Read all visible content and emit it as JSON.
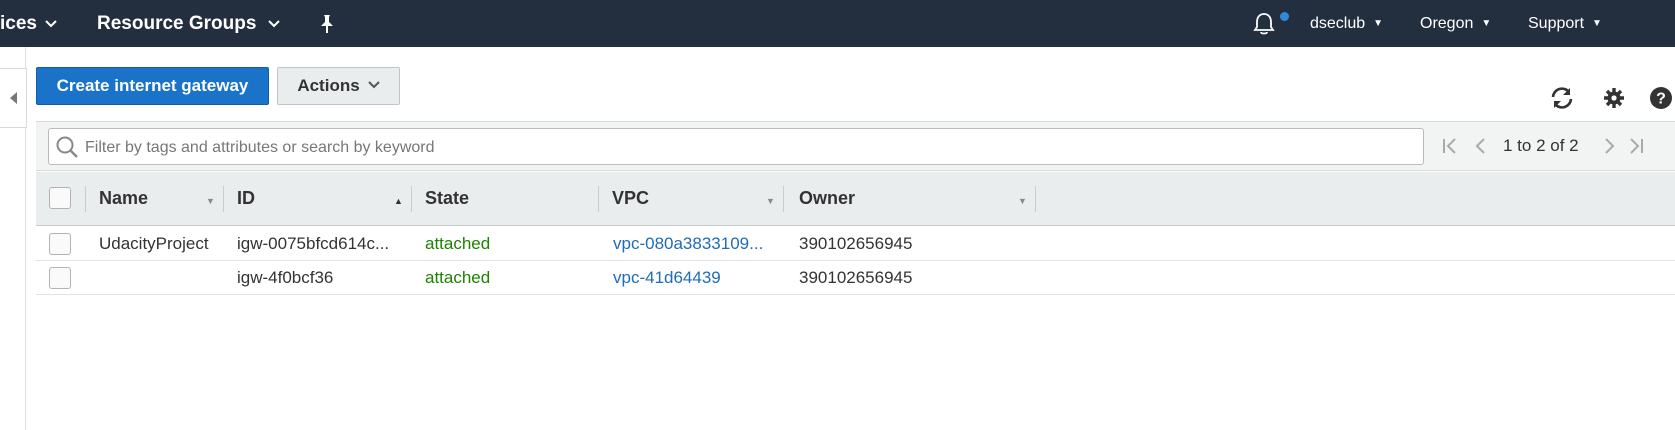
{
  "topbar": {
    "services_label": "ices",
    "resource_groups_label": "Resource Groups",
    "account_label": "dseclub",
    "region_label": "Oregon",
    "support_label": "Support"
  },
  "toolbar": {
    "create_label": "Create internet gateway",
    "actions_label": "Actions"
  },
  "filter": {
    "placeholder": "Filter by tags and attributes or search by keyword",
    "pager_text": "1 to 2 of 2"
  },
  "table": {
    "columns": [
      "Name",
      "ID",
      "State",
      "VPC",
      "Owner"
    ],
    "rows": [
      {
        "name": "UdacityProject",
        "id": "igw-0075bfcd614c...",
        "state": "attached",
        "vpc": "vpc-080a3833109...",
        "owner": "390102656945"
      },
      {
        "name": "",
        "id": "igw-4f0bcf36",
        "state": "attached",
        "vpc": "vpc-41d64439",
        "owner": "390102656945"
      }
    ]
  },
  "colors": {
    "nav_bg": "#232f3e",
    "primary": "#1a73c9",
    "state_green": "#1d8102",
    "link_blue": "#1f6cb8"
  }
}
